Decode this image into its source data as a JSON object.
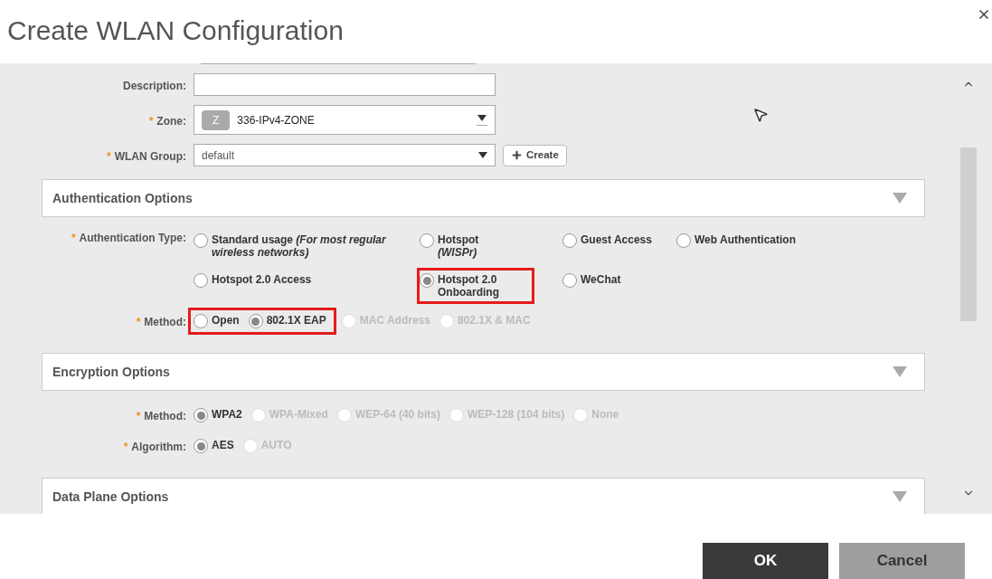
{
  "window": {
    "title": "Create WLAN Configuration"
  },
  "general": [
    {
      "kind": "text",
      "label": "Description:"
    },
    {
      "kind": "zone",
      "label": "Zone:",
      "mark": "*",
      "badge": "Z",
      "value": "336-IPv4-ZONE"
    },
    {
      "kind": "select",
      "label": "WLAN Group:",
      "mark": "*",
      "value": "default",
      "button": "Create"
    }
  ],
  "sections": [
    {
      "title": "Authentication Options",
      "fields": [
        {
          "kind": "grid",
          "label": "Authentication Type:",
          "mark": "*",
          "rows": [
            [
              {
                "text": "Standard usage *(For most regular wireless networks)*",
                "selected": false,
                "disabled": false,
                "highlighted": false
              },
              {
                "text": "Hotspot *(WISPr)*",
                "selected": false,
                "disabled": false,
                "highlighted": false
              },
              {
                "text": "Guest Access",
                "selected": false,
                "disabled": false,
                "highlighted": false
              },
              {
                "text": "Web Authentication",
                "selected": false,
                "disabled": false,
                "highlighted": false
              }
            ],
            [
              {
                "text": "Hotspot 2.0 Access",
                "selected": false,
                "disabled": false,
                "highlighted": false
              },
              {
                "text": "Hotspot 2.0 Onboarding",
                "selected": true,
                "disabled": false,
                "highlighted": true
              },
              {
                "text": "WeChat",
                "selected": false,
                "disabled": false,
                "highlighted": false
              }
            ]
          ]
        },
        {
          "kind": "inline",
          "label": "Method:",
          "mark": "*",
          "options": [
            {
              "text": "Open",
              "selected": false,
              "disabled": false,
              "highlighted": true
            },
            {
              "text": "802.1X EAP",
              "selected": true,
              "disabled": false,
              "highlighted": true
            },
            {
              "text": "MAC Address",
              "selected": false,
              "disabled": true,
              "highlighted": false
            },
            {
              "text": "802.1X & MAC",
              "selected": false,
              "disabled": true,
              "highlighted": false
            }
          ]
        }
      ]
    },
    {
      "title": "Encryption Options",
      "fields": [
        {
          "kind": "inline",
          "label": "Method:",
          "mark": "*",
          "options": [
            {
              "text": "WPA2",
              "selected": true,
              "disabled": false,
              "highlighted": false
            },
            {
              "text": "WPA-Mixed",
              "selected": false,
              "disabled": true,
              "highlighted": false
            },
            {
              "text": "WEP-64 (40 bits)",
              "selected": false,
              "disabled": true,
              "highlighted": false
            },
            {
              "text": "WEP-128 (104 bits)",
              "selected": false,
              "disabled": true,
              "highlighted": false
            },
            {
              "text": "None",
              "selected": false,
              "disabled": true,
              "highlighted": false
            }
          ]
        },
        {
          "kind": "inline",
          "label": "Algorithm:",
          "mark": "*",
          "options": [
            {
              "text": "AES",
              "selected": true,
              "disabled": false,
              "highlighted": false
            },
            {
              "text": "AUTO",
              "selected": false,
              "disabled": true,
              "highlighted": false
            }
          ]
        }
      ]
    },
    {
      "title": "Data Plane Options"
    }
  ],
  "buttons": [
    {
      "label": "OK",
      "kind": "primary"
    },
    {
      "label": "Cancel",
      "kind": "secondary"
    }
  ]
}
